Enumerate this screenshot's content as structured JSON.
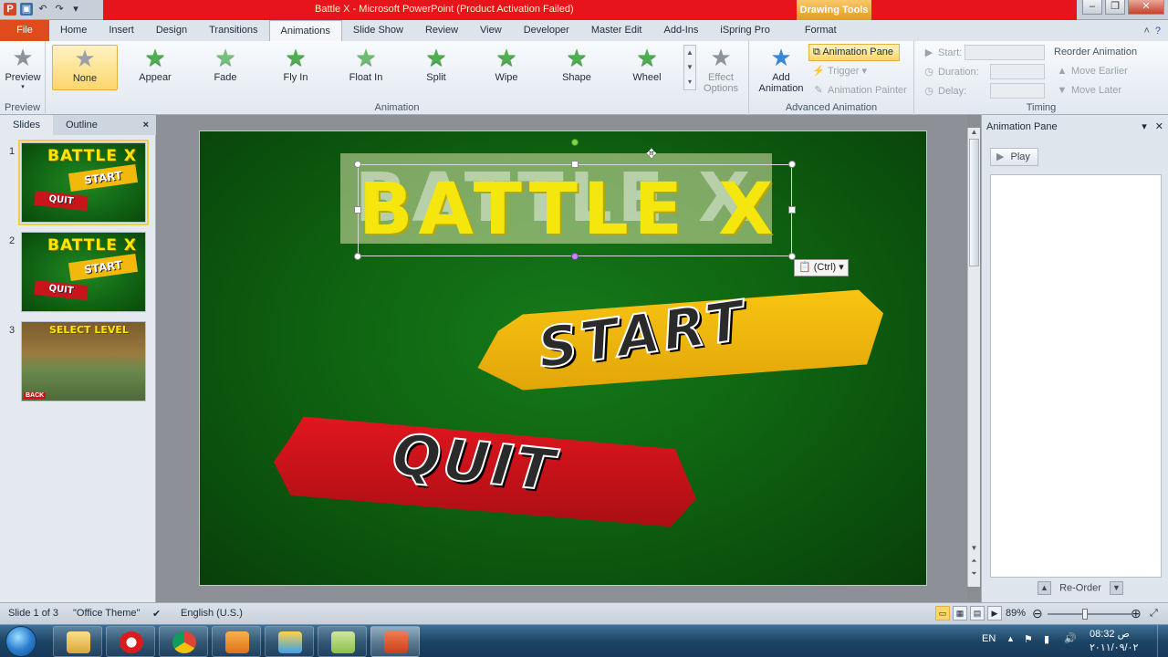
{
  "window": {
    "title": "Battle X  -  Microsoft PowerPoint (Product Activation Failed)",
    "contextual_tab": "Drawing Tools",
    "minimize_icon": "minimize-icon",
    "maximize_icon": "restore-icon",
    "close_icon": "close-icon"
  },
  "tabs": [
    "File",
    "Home",
    "Insert",
    "Design",
    "Transitions",
    "Animations",
    "Slide Show",
    "Review",
    "View",
    "Developer",
    "Master Edit",
    "Add-Ins",
    "iSpring Pro",
    "Format"
  ],
  "active_tab": "Animations",
  "ribbon": {
    "preview": {
      "label": "Preview",
      "group": "Preview"
    },
    "animations": {
      "items": [
        {
          "label": "None",
          "selected": true
        },
        {
          "label": "Appear"
        },
        {
          "label": "Fade"
        },
        {
          "label": "Fly In"
        },
        {
          "label": "Float In"
        },
        {
          "label": "Split"
        },
        {
          "label": "Wipe"
        },
        {
          "label": "Shape"
        },
        {
          "label": "Wheel"
        }
      ],
      "effect_options_line1": "Effect",
      "effect_options_line2": "Options",
      "group": "Animation"
    },
    "advanced": {
      "add_animation_line1": "Add",
      "add_animation_line2": "Animation",
      "animation_pane": "Animation Pane",
      "trigger": "Trigger",
      "animation_painter": "Animation Painter",
      "group": "Advanced Animation"
    },
    "timing": {
      "start": "Start:",
      "duration": "Duration:",
      "delay": "Delay:",
      "reorder": "Reorder Animation",
      "move_earlier": "Move Earlier",
      "move_later": "Move Later",
      "group": "Timing"
    }
  },
  "left_pane": {
    "tabs": [
      "Slides",
      "Outline"
    ],
    "close": "×",
    "slides": [
      {
        "number": "1",
        "title": "BATTLE X",
        "start": "START",
        "quit": "QUIT"
      },
      {
        "number": "2",
        "title": "BATTLE X",
        "start": "START",
        "quit": "QUIT"
      },
      {
        "number": "3",
        "title": "SELECT LEVEL",
        "back": "BACK"
      }
    ]
  },
  "slide": {
    "title": "BATTLE X",
    "start_button": "START",
    "quit_button": "QUIT",
    "paste_tag": "(Ctrl)"
  },
  "animation_pane": {
    "title": "Animation Pane",
    "play": "Play",
    "reorder": "Re-Order"
  },
  "status": {
    "slide_info": "Slide 1 of 3",
    "theme": "\"Office Theme\"",
    "language": "English (U.S.)",
    "zoom": "89%",
    "zoom_level": 0.45
  },
  "taskbar": {
    "apps": [
      "explorer-icon",
      "opera-icon",
      "chrome-icon",
      "media-player-icon",
      "paint-icon",
      "notes-icon",
      "powerpoint-icon"
    ],
    "active_app": "powerpoint-icon",
    "language": "EN",
    "time": "08:32",
    "ampm": "ص",
    "date": "٢٠١١/٠٩/٠٢"
  }
}
